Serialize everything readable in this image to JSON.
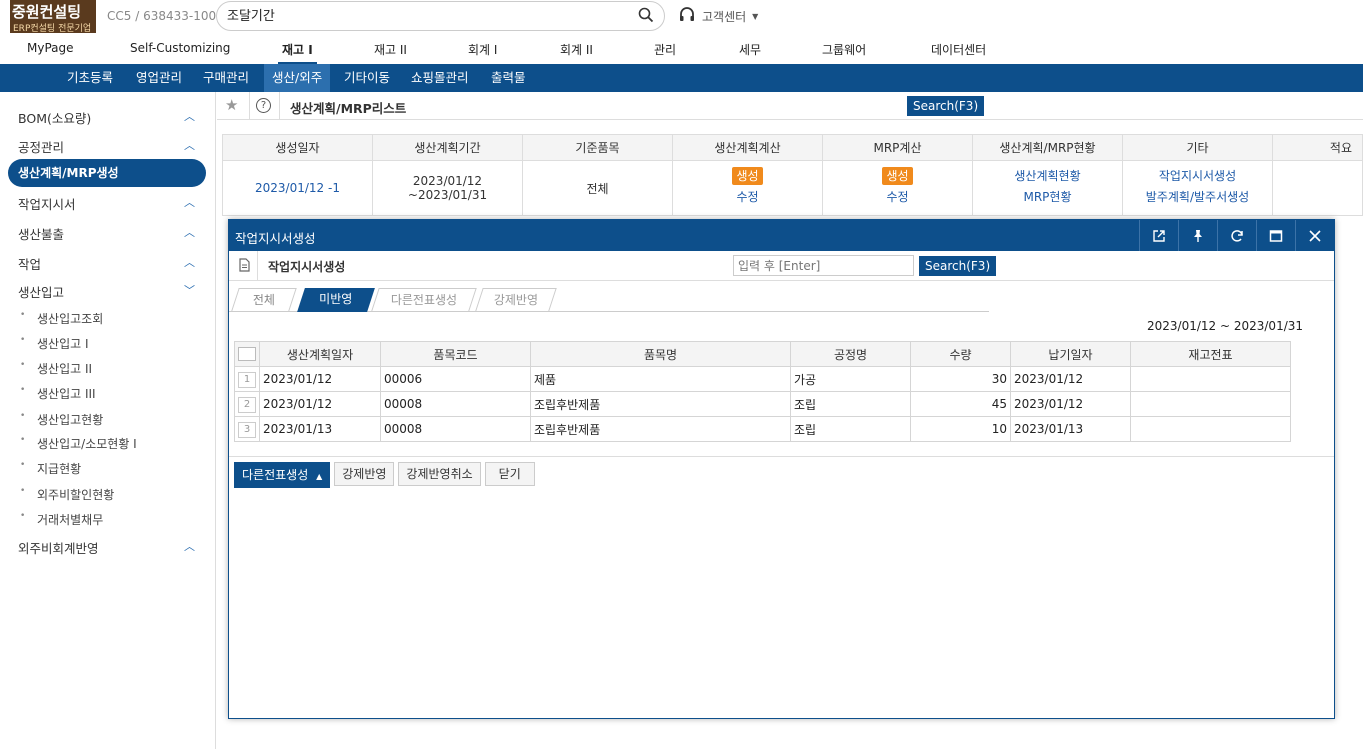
{
  "logo": {
    "title": "중원컨설팅",
    "subtitle": "ERP컨설팅 전문기업"
  },
  "company": "CC5 / 638433-100",
  "search": {
    "value": "조달기간"
  },
  "support": "고객센터",
  "top_menu": [
    "MyPage",
    "Self-Customizing",
    "재고 I",
    "재고 II",
    "회계 I",
    "회계 II",
    "관리",
    "세무",
    "그룹웨어",
    "데이터센터"
  ],
  "nav": [
    "기초등록",
    "영업관리",
    "구매관리",
    "생산/외주",
    "기타이동",
    "쇼핑몰관리",
    "출력물"
  ],
  "sidebar": {
    "groups": [
      "BOM(소요량)",
      "공정관리",
      "생산계획/MRP생성",
      "작업지시서",
      "생산불출",
      "작업",
      "생산입고",
      "외주비회계반영"
    ],
    "sub_items": [
      "생산입고조회",
      "생산입고 I",
      "생산입고 II",
      "생산입고 III",
      "생산입고현황",
      "생산입고/소모현황 I",
      "지급현황",
      "외주비할인현황",
      "거래처별채무"
    ]
  },
  "page": {
    "title": "생산계획/MRP리스트",
    "search_btn": "Search(F3)"
  },
  "main_table": {
    "headers": [
      "생성일자",
      "생산계획기간",
      "기준품목",
      "생산계획계산",
      "MRP계산",
      "생산계획/MRP현황",
      "기타",
      "적요"
    ],
    "row": {
      "date": "2023/01/12 -1",
      "period": "2023/01/12 ~2023/01/31",
      "base": "전체",
      "calc_badge": "생성",
      "calc_edit": "수정",
      "mrp_badge": "생성",
      "mrp_edit": "수정",
      "status1": "생산계획현황",
      "status2": "MRP현황",
      "etc1": "작업지시서생성",
      "etc2": "발주계획/발주서생성"
    }
  },
  "popup": {
    "title": "작업지시서생성",
    "subtitle": "작업지시서생성",
    "input_placeholder": "입력 후 [Enter]",
    "search_btn": "Search(F3)",
    "tabs": [
      "전체",
      "미반영",
      "다른전표생성",
      "강제반영"
    ],
    "date_range": "2023/01/12 ~ 2023/01/31",
    "headers": [
      "생산계획일자",
      "품목코드",
      "품목명",
      "공정명",
      "수량",
      "납기일자",
      "재고전표"
    ],
    "rows": [
      {
        "n": "1",
        "date": "2023/01/12",
        "code": "00006",
        "name": "제품",
        "proc": "가공",
        "qty": "30",
        "due": "2023/01/12",
        "slip": ""
      },
      {
        "n": "2",
        "date": "2023/01/12",
        "code": "00008",
        "name": "조립후반제품",
        "proc": "조립",
        "qty": "45",
        "due": "2023/01/12",
        "slip": ""
      },
      {
        "n": "3",
        "date": "2023/01/13",
        "code": "00008",
        "name": "조립후반제품",
        "proc": "조립",
        "qty": "10",
        "due": "2023/01/13",
        "slip": ""
      }
    ],
    "buttons": [
      "다른전표생성",
      "강제반영",
      "강제반영취소",
      "닫기"
    ]
  },
  "colors": {
    "primary": "#0d4f8b",
    "badge": "#f08a1c",
    "brand": "#5a3a1e"
  }
}
